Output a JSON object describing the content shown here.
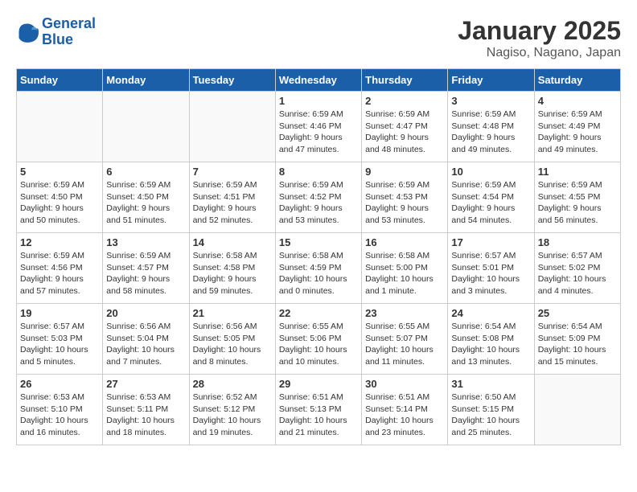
{
  "header": {
    "logo_line1": "General",
    "logo_line2": "Blue",
    "month": "January 2025",
    "location": "Nagiso, Nagano, Japan"
  },
  "weekdays": [
    "Sunday",
    "Monday",
    "Tuesday",
    "Wednesday",
    "Thursday",
    "Friday",
    "Saturday"
  ],
  "weeks": [
    [
      {
        "day": "",
        "info": ""
      },
      {
        "day": "",
        "info": ""
      },
      {
        "day": "",
        "info": ""
      },
      {
        "day": "1",
        "info": "Sunrise: 6:59 AM\nSunset: 4:46 PM\nDaylight: 9 hours and 47 minutes."
      },
      {
        "day": "2",
        "info": "Sunrise: 6:59 AM\nSunset: 4:47 PM\nDaylight: 9 hours and 48 minutes."
      },
      {
        "day": "3",
        "info": "Sunrise: 6:59 AM\nSunset: 4:48 PM\nDaylight: 9 hours and 49 minutes."
      },
      {
        "day": "4",
        "info": "Sunrise: 6:59 AM\nSunset: 4:49 PM\nDaylight: 9 hours and 49 minutes."
      }
    ],
    [
      {
        "day": "5",
        "info": "Sunrise: 6:59 AM\nSunset: 4:50 PM\nDaylight: 9 hours and 50 minutes."
      },
      {
        "day": "6",
        "info": "Sunrise: 6:59 AM\nSunset: 4:50 PM\nDaylight: 9 hours and 51 minutes."
      },
      {
        "day": "7",
        "info": "Sunrise: 6:59 AM\nSunset: 4:51 PM\nDaylight: 9 hours and 52 minutes."
      },
      {
        "day": "8",
        "info": "Sunrise: 6:59 AM\nSunset: 4:52 PM\nDaylight: 9 hours and 53 minutes."
      },
      {
        "day": "9",
        "info": "Sunrise: 6:59 AM\nSunset: 4:53 PM\nDaylight: 9 hours and 53 minutes."
      },
      {
        "day": "10",
        "info": "Sunrise: 6:59 AM\nSunset: 4:54 PM\nDaylight: 9 hours and 54 minutes."
      },
      {
        "day": "11",
        "info": "Sunrise: 6:59 AM\nSunset: 4:55 PM\nDaylight: 9 hours and 56 minutes."
      }
    ],
    [
      {
        "day": "12",
        "info": "Sunrise: 6:59 AM\nSunset: 4:56 PM\nDaylight: 9 hours and 57 minutes."
      },
      {
        "day": "13",
        "info": "Sunrise: 6:59 AM\nSunset: 4:57 PM\nDaylight: 9 hours and 58 minutes."
      },
      {
        "day": "14",
        "info": "Sunrise: 6:58 AM\nSunset: 4:58 PM\nDaylight: 9 hours and 59 minutes."
      },
      {
        "day": "15",
        "info": "Sunrise: 6:58 AM\nSunset: 4:59 PM\nDaylight: 10 hours and 0 minutes."
      },
      {
        "day": "16",
        "info": "Sunrise: 6:58 AM\nSunset: 5:00 PM\nDaylight: 10 hours and 1 minute."
      },
      {
        "day": "17",
        "info": "Sunrise: 6:57 AM\nSunset: 5:01 PM\nDaylight: 10 hours and 3 minutes."
      },
      {
        "day": "18",
        "info": "Sunrise: 6:57 AM\nSunset: 5:02 PM\nDaylight: 10 hours and 4 minutes."
      }
    ],
    [
      {
        "day": "19",
        "info": "Sunrise: 6:57 AM\nSunset: 5:03 PM\nDaylight: 10 hours and 5 minutes."
      },
      {
        "day": "20",
        "info": "Sunrise: 6:56 AM\nSunset: 5:04 PM\nDaylight: 10 hours and 7 minutes."
      },
      {
        "day": "21",
        "info": "Sunrise: 6:56 AM\nSunset: 5:05 PM\nDaylight: 10 hours and 8 minutes."
      },
      {
        "day": "22",
        "info": "Sunrise: 6:55 AM\nSunset: 5:06 PM\nDaylight: 10 hours and 10 minutes."
      },
      {
        "day": "23",
        "info": "Sunrise: 6:55 AM\nSunset: 5:07 PM\nDaylight: 10 hours and 11 minutes."
      },
      {
        "day": "24",
        "info": "Sunrise: 6:54 AM\nSunset: 5:08 PM\nDaylight: 10 hours and 13 minutes."
      },
      {
        "day": "25",
        "info": "Sunrise: 6:54 AM\nSunset: 5:09 PM\nDaylight: 10 hours and 15 minutes."
      }
    ],
    [
      {
        "day": "26",
        "info": "Sunrise: 6:53 AM\nSunset: 5:10 PM\nDaylight: 10 hours and 16 minutes."
      },
      {
        "day": "27",
        "info": "Sunrise: 6:53 AM\nSunset: 5:11 PM\nDaylight: 10 hours and 18 minutes."
      },
      {
        "day": "28",
        "info": "Sunrise: 6:52 AM\nSunset: 5:12 PM\nDaylight: 10 hours and 19 minutes."
      },
      {
        "day": "29",
        "info": "Sunrise: 6:51 AM\nSunset: 5:13 PM\nDaylight: 10 hours and 21 minutes."
      },
      {
        "day": "30",
        "info": "Sunrise: 6:51 AM\nSunset: 5:14 PM\nDaylight: 10 hours and 23 minutes."
      },
      {
        "day": "31",
        "info": "Sunrise: 6:50 AM\nSunset: 5:15 PM\nDaylight: 10 hours and 25 minutes."
      },
      {
        "day": "",
        "info": ""
      }
    ]
  ]
}
